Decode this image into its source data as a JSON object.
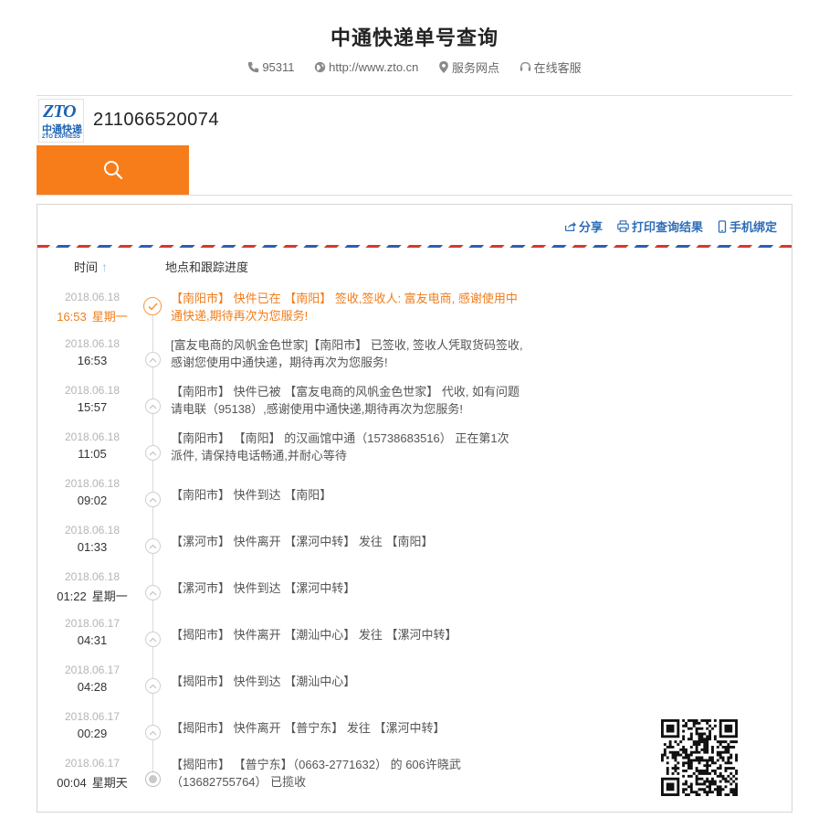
{
  "header": {
    "title": "中通快递单号查询",
    "phone": "95311",
    "website": "http://www.zto.cn",
    "service_points": "服务网点",
    "online_service": "在线客服"
  },
  "logo": {
    "brand": "ZTO",
    "cn": "中通快递",
    "en": "ZTO EXPRESS"
  },
  "search": {
    "tracking_number": "211066520074"
  },
  "actions": {
    "share": "分享",
    "print": "打印查询结果",
    "bind_phone": "手机绑定"
  },
  "table": {
    "time_header": "时间",
    "sort_indicator": "↑",
    "location_header": "地点和跟踪进度"
  },
  "events": [
    {
      "date": "2018.06.18",
      "time": "16:53",
      "weekday": "星期一",
      "line1": "【南阳市】 快件已在 【南阳】 签收,签收人: 富友电商, 感谢使用中",
      "line2": "通快递,期待再次为您服务!"
    },
    {
      "date": "2018.06.18",
      "time": "16:53",
      "weekday": "",
      "line1": "[富友电商的风帆金色世家]【南阳市】 已签收, 签收人凭取货码签收,",
      "line2": "感谢您使用中通快递，期待再次为您服务!"
    },
    {
      "date": "2018.06.18",
      "time": "15:57",
      "weekday": "",
      "line1": "【南阳市】 快件已被 【富友电商的风帆金色世家】 代收, 如有问题",
      "line2": "请电联（95138）,感谢使用中通快递,期待再次为您服务!"
    },
    {
      "date": "2018.06.18",
      "time": "11:05",
      "weekday": "",
      "line1": "【南阳市】 【南阳】 的汉画馆中通（15738683516） 正在第1次",
      "line2": "派件, 请保持电话畅通,并耐心等待"
    },
    {
      "date": "2018.06.18",
      "time": "09:02",
      "weekday": "",
      "line1": "【南阳市】 快件到达 【南阳】",
      "line2": ""
    },
    {
      "date": "2018.06.18",
      "time": "01:33",
      "weekday": "",
      "line1": "【漯河市】 快件离开 【漯河中转】 发往 【南阳】",
      "line2": ""
    },
    {
      "date": "2018.06.18",
      "time": "01:22",
      "weekday": "星期一",
      "line1": "【漯河市】 快件到达 【漯河中转】",
      "line2": ""
    },
    {
      "date": "2018.06.17",
      "time": "04:31",
      "weekday": "",
      "line1": "【揭阳市】 快件离开 【潮汕中心】 发往 【漯河中转】",
      "line2": ""
    },
    {
      "date": "2018.06.17",
      "time": "04:28",
      "weekday": "",
      "line1": "【揭阳市】 快件到达 【潮汕中心】",
      "line2": ""
    },
    {
      "date": "2018.06.17",
      "time": "00:29",
      "weekday": "",
      "line1": "【揭阳市】 快件离开 【普宁东】 发往 【漯河中转】",
      "line2": ""
    },
    {
      "date": "2018.06.17",
      "time": "00:04",
      "weekday": "星期天",
      "line1": "【揭阳市】 【普宁东】（0663-2771632） 的 606许晓武",
      "line2": "（13682755764） 已揽收"
    }
  ]
}
